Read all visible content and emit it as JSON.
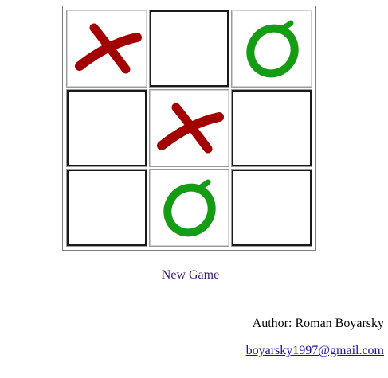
{
  "board": {
    "cells": [
      {
        "mark": "X"
      },
      {
        "mark": ""
      },
      {
        "mark": "O"
      },
      {
        "mark": ""
      },
      {
        "mark": "X"
      },
      {
        "mark": ""
      },
      {
        "mark": ""
      },
      {
        "mark": "O"
      },
      {
        "mark": ""
      }
    ]
  },
  "colors": {
    "x_mark": "#a30000",
    "o_mark": "#169c14",
    "new_game": "#3c1a78",
    "email_link": "#1a0dab"
  },
  "icons": {
    "x": "cross-mark-icon",
    "o": "circle-mark-icon"
  },
  "controls": {
    "new_game_label": "New Game"
  },
  "footer": {
    "author": "Author: Roman Boyarsky",
    "email": "boyarsky1997@gmail.com"
  }
}
